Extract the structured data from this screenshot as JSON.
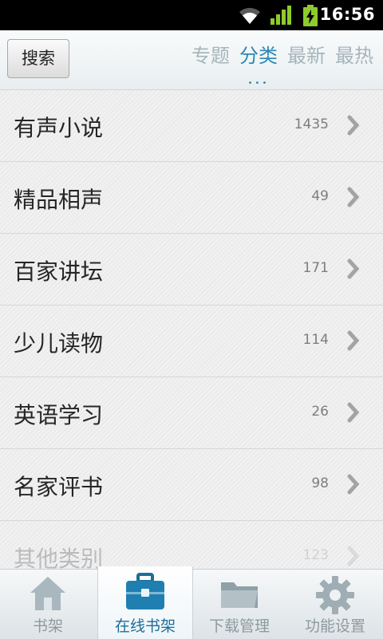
{
  "status_bar": {
    "time": "16:56",
    "icons": [
      "wifi-icon",
      "signal-icon",
      "battery-charging-icon"
    ]
  },
  "header": {
    "search_label": "搜索",
    "tabs": [
      {
        "label": "专题",
        "active": false
      },
      {
        "label": "分类",
        "active": true
      },
      {
        "label": "最新",
        "active": false
      },
      {
        "label": "最热",
        "active": false
      }
    ],
    "active_indicator": "•••"
  },
  "categories": [
    {
      "label": "有声小说",
      "count": "1435"
    },
    {
      "label": "精品相声",
      "count": "49"
    },
    {
      "label": "百家讲坛",
      "count": "171"
    },
    {
      "label": "少儿读物",
      "count": "114"
    },
    {
      "label": "英语学习",
      "count": "26"
    },
    {
      "label": "名家评书",
      "count": "98"
    },
    {
      "label": "其他类别",
      "count": "123"
    }
  ],
  "bottom_nav": [
    {
      "label": "书架",
      "icon": "home-icon",
      "active": false
    },
    {
      "label": "在线书架",
      "icon": "briefcase-icon",
      "active": true
    },
    {
      "label": "下载管理",
      "icon": "folder-icon",
      "active": false
    },
    {
      "label": "功能设置",
      "icon": "gear-icon",
      "active": false
    }
  ],
  "colors": {
    "accent": "#2c87b5",
    "tab_inactive": "#a6b5bc",
    "bottom_inactive": "#8e9aa0"
  }
}
